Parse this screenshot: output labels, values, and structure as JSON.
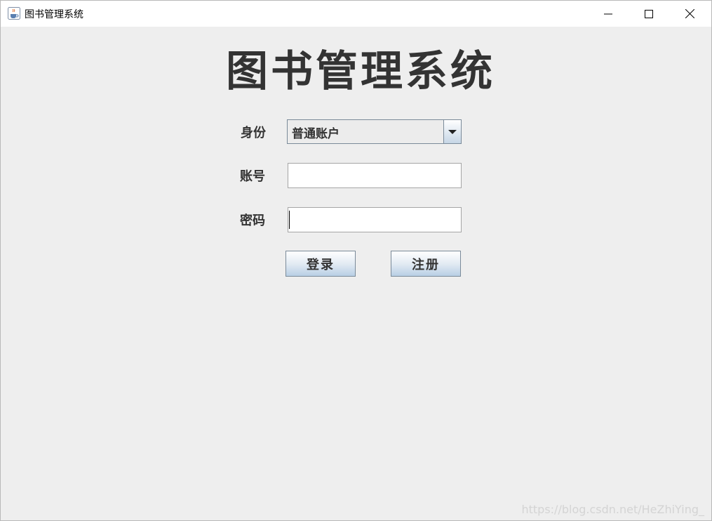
{
  "window": {
    "title": "图书管理系统",
    "icon": "java-cup-icon"
  },
  "main": {
    "heading": "图书管理系统",
    "identity_label": "身份",
    "identity_selected": "普通账户",
    "account_label": "账号",
    "account_value": "",
    "password_label": "密码",
    "password_value": "",
    "login_button": "登录",
    "register_button": "注册"
  },
  "watermark": "https://blog.csdn.net/HeZhiYing_",
  "colors": {
    "background": "#eeeeee",
    "text": "#333333",
    "button_gradient_bottom": "#b8cfe5"
  }
}
